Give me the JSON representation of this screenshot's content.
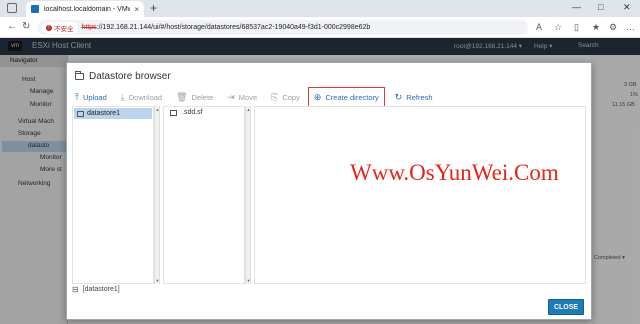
{
  "browser": {
    "tab_title": "localhost.localdomain - VMware E",
    "tab_close": "×",
    "new_tab": "+",
    "insecure_label": "不安全",
    "url_scheme": "https",
    "url_rest": "://192.168.21.144/ui/#/host/storage/datastores/68537ac2-19040a49-f3d1-000c2998e62b",
    "back": "←",
    "reload": "↻",
    "minimize": "—",
    "maximize": "□",
    "close": "✕"
  },
  "esxi": {
    "logo": "vm",
    "title": "ESXi Host Client",
    "user": "root@192.168.21.144 ▾",
    "help": "Help ▾",
    "search": "Search",
    "navigator": "Navigator",
    "nav_items": [
      "Host",
      "Manage",
      "Monitor",
      "Virtual Mach",
      "Storage",
      "datasto",
      "Monitor",
      "More st",
      "Networking"
    ],
    "right_values": [
      "3 GB",
      "1%",
      "11.15 GB",
      "Completed ▾"
    ]
  },
  "modal": {
    "title": "Datastore browser",
    "toolbar": [
      {
        "label": "Upload",
        "icon": "⤒",
        "enabled": true
      },
      {
        "label": "Download",
        "icon": "⤓",
        "enabled": false
      },
      {
        "label": "Delete",
        "icon": "🗑",
        "enabled": false
      },
      {
        "label": "Move",
        "icon": "⇥",
        "enabled": false
      },
      {
        "label": "Copy",
        "icon": "⎘",
        "enabled": false
      },
      {
        "label": "Create directory",
        "icon": "⊕",
        "enabled": true
      },
      {
        "label": "Refresh",
        "icon": "↻",
        "enabled": true
      }
    ],
    "datastores": [
      "datastore1"
    ],
    "files": [
      ".sdd.sf"
    ],
    "path": "[datastore1]",
    "close_label": "CLOSE"
  },
  "watermark": "Www.OsYunWei.Com"
}
